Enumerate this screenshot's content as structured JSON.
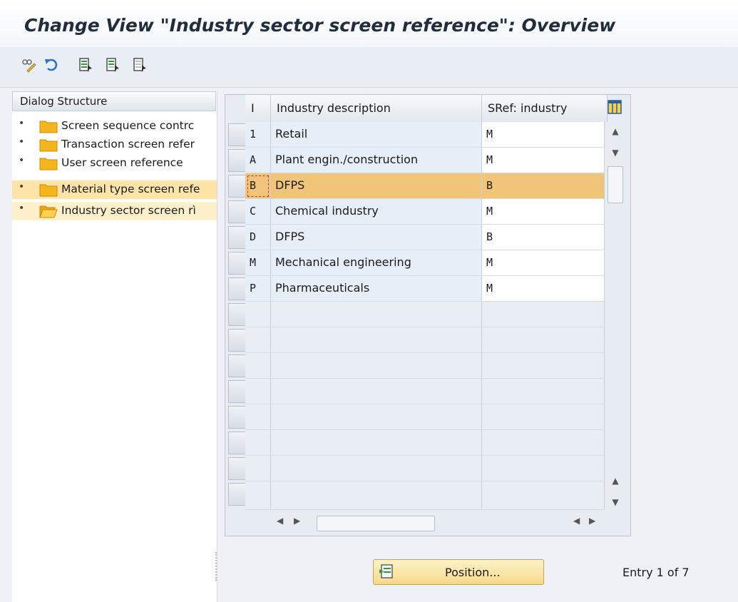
{
  "header": {
    "title": "Change View \"Industry sector screen reference\": Overview"
  },
  "toolbar": {
    "buttons": [
      {
        "icon": "display-change-icon"
      },
      {
        "icon": "undo-icon"
      },
      {
        "icon": "select-all-icon"
      },
      {
        "icon": "select-block-icon"
      },
      {
        "icon": "deselect-all-icon"
      }
    ]
  },
  "dialog_structure": {
    "header": "Dialog Structure",
    "items": [
      {
        "label": "Screen sequence contrc",
        "state": "normal"
      },
      {
        "label": "Transaction screen refer",
        "state": "normal"
      },
      {
        "label": "User screen reference",
        "state": "normal"
      },
      {
        "label": "Material type screen refe",
        "state": "selected"
      },
      {
        "label": "Industry sector screen rì",
        "state": "current"
      }
    ]
  },
  "table": {
    "columns": [
      "I",
      "Industry description",
      "SRef: industry"
    ],
    "rows": [
      {
        "key": "1",
        "description": "Retail",
        "sref": "M"
      },
      {
        "key": "A",
        "description": "Plant engin./construction",
        "sref": "M"
      },
      {
        "key": "B",
        "description": "DFPS",
        "sref": "B",
        "selected": true
      },
      {
        "key": "C",
        "description": "Chemical industry",
        "sref": "M"
      },
      {
        "key": "D",
        "description": "DFPS",
        "sref": "B"
      },
      {
        "key": "M",
        "description": "Mechanical engineering",
        "sref": "M"
      },
      {
        "key": "P",
        "description": "Pharmaceuticals",
        "sref": "M"
      }
    ],
    "empty_rows": 9
  },
  "footer": {
    "position_button": "Position...",
    "entry_count": "Entry 1 of 7"
  },
  "colors": {
    "selected_row": "#f0c57a",
    "selected_tree": "#ffe4a8",
    "button": "#f6d98a"
  }
}
